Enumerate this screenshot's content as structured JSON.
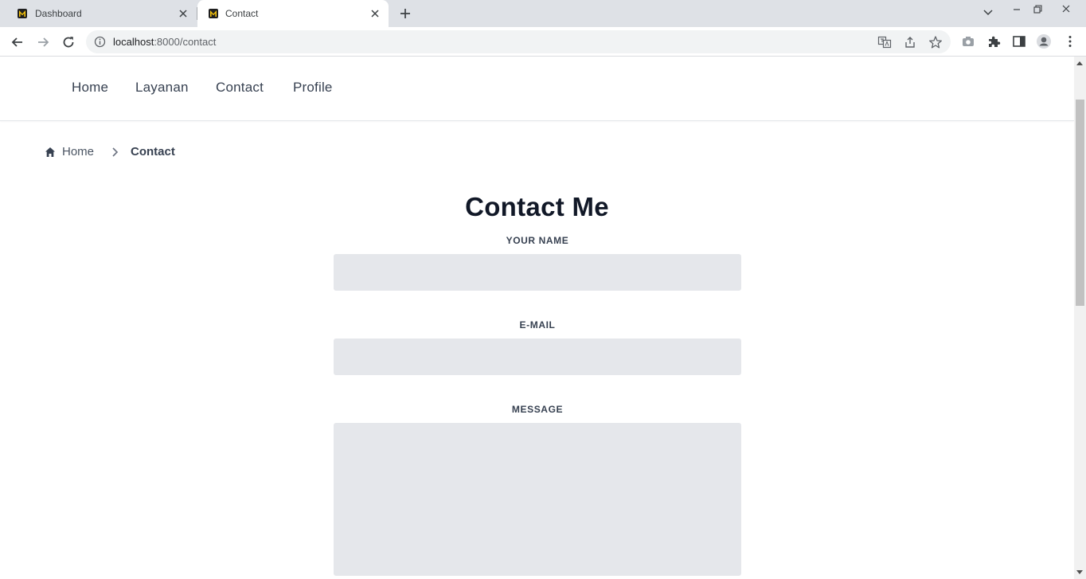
{
  "browser": {
    "tabs": [
      {
        "title": "Dashboard",
        "active": false
      },
      {
        "title": "Contact",
        "active": true
      }
    ],
    "address_bar": {
      "host": "localhost",
      "path": ":8000/contact"
    }
  },
  "site_nav": {
    "items": [
      "Home",
      "Layanan",
      "Contact",
      "Profile"
    ]
  },
  "breadcrumb": {
    "home": "Home",
    "current": "Contact"
  },
  "contact_form": {
    "title": "Contact Me",
    "name_label": "YOUR NAME",
    "name_value": "",
    "email_label": "E-MAIL",
    "email_value": "",
    "message_label": "MESSAGE",
    "message_value": ""
  },
  "colors": {
    "tabstrip_bg": "#dee1e6",
    "input_bg": "#e5e7eb",
    "text_dark": "#111827",
    "nav_text": "#374151"
  }
}
